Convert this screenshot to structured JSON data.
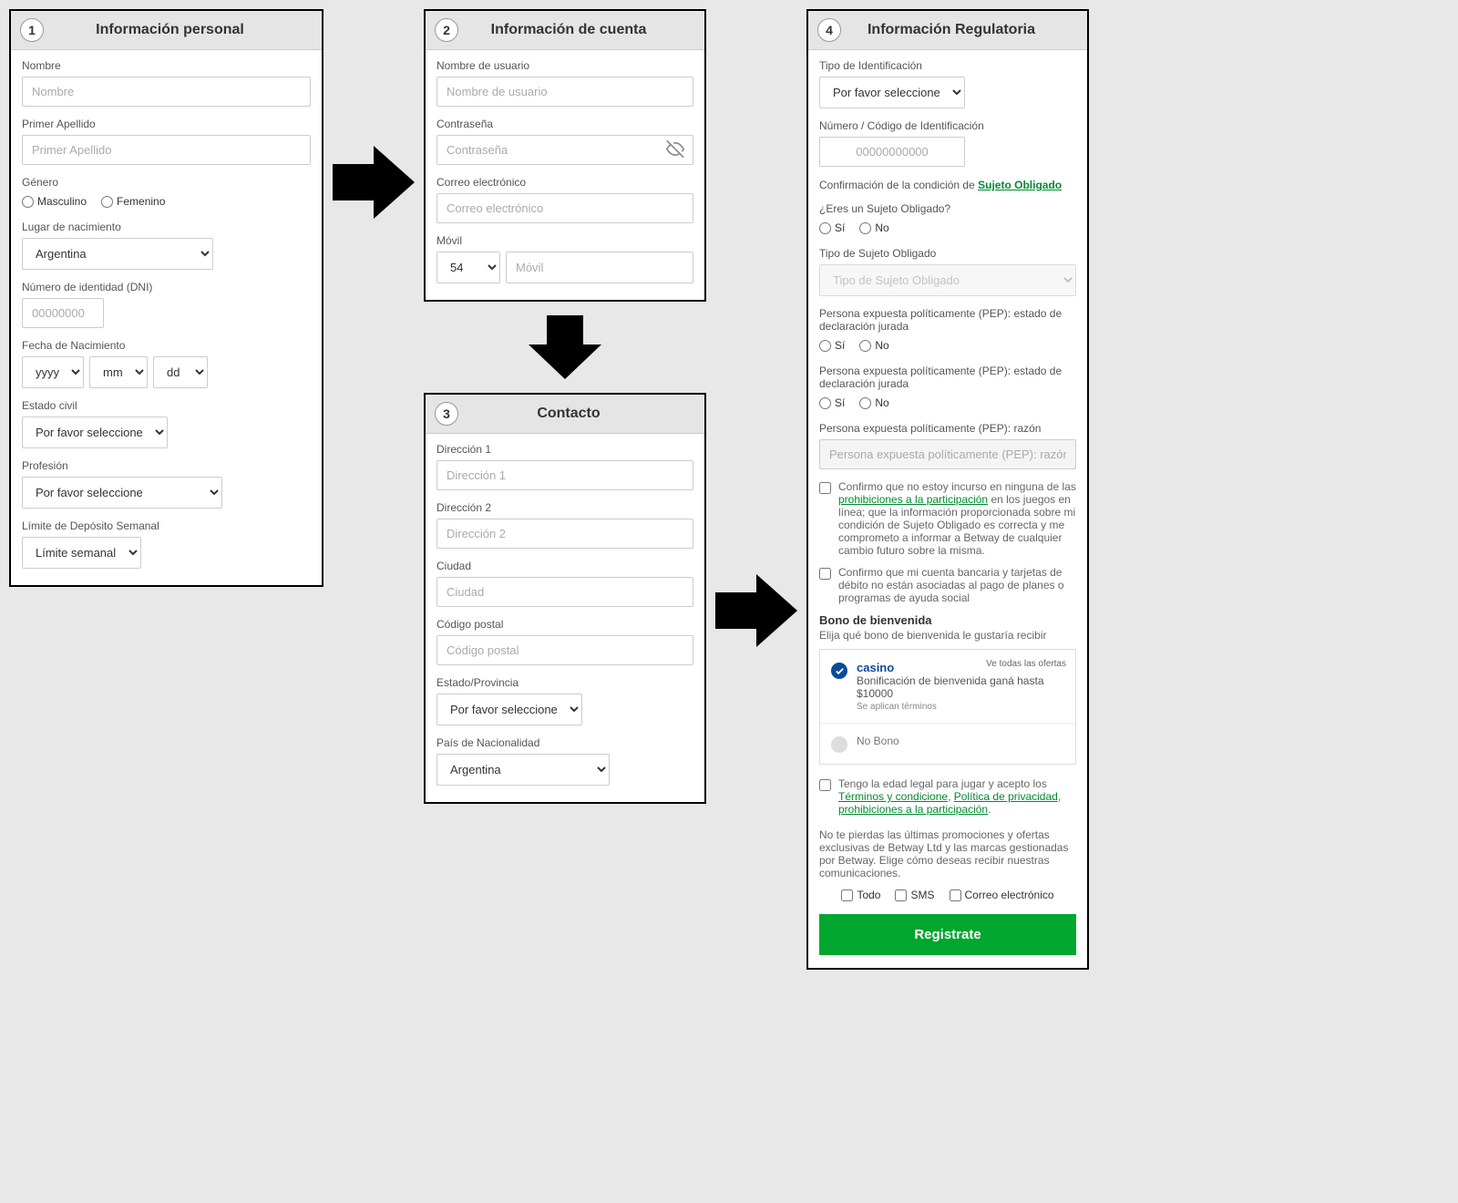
{
  "step1": {
    "number": "1",
    "title": "Información personal",
    "nombre_label": "Nombre",
    "nombre_placeholder": "Nombre",
    "apellido_label": "Primer Apellido",
    "apellido_placeholder": "Primer Apellido",
    "genero_label": "Género",
    "genero_m": "Masculino",
    "genero_f": "Femenino",
    "lugar_label": "Lugar de nacimiento",
    "lugar_value": "Argentina",
    "dni_label": "Número de identidad (DNI)",
    "dni_placeholder": "00000000",
    "fecha_label": "Fecha de Nacimiento",
    "yyyy": "yyyy",
    "mm": "mm",
    "dd": "dd",
    "estado_label": "Estado civil",
    "estado_value": "Por favor seleccione",
    "profesion_label": "Profesión",
    "profesion_value": "Por favor seleccione",
    "limite_label": "Límite de Depósito Semanal",
    "limite_value": "Límite semanal"
  },
  "step2": {
    "number": "2",
    "title": "Información de cuenta",
    "usuario_label": "Nombre de usuario",
    "usuario_placeholder": "Nombre de usuario",
    "contrasena_label": "Contraseña",
    "contrasena_placeholder": "Contraseña",
    "correo_label": "Correo electrónico",
    "correo_placeholder": "Correo electrónico",
    "movil_label": "Móvil",
    "movil_code": "54",
    "movil_placeholder": "Móvil"
  },
  "step3": {
    "number": "3",
    "title": "Contacto",
    "dir1_label": "Dirección 1",
    "dir1_placeholder": "Dirección 1",
    "dir2_label": "Dirección 2",
    "dir2_placeholder": "Dirección 2",
    "ciudad_label": "Ciudad",
    "ciudad_placeholder": "Ciudad",
    "cp_label": "Código postal",
    "cp_placeholder": "Código postal",
    "provincia_label": "Estado/Provincia",
    "provincia_value": "Por favor seleccione",
    "pais_label": "País de Nacionalidad",
    "pais_value": "Argentina"
  },
  "step4": {
    "number": "4",
    "title": "Información Regulatoria",
    "tipo_id_label": "Tipo de Identificación",
    "tipo_id_value": "Por favor seleccione",
    "num_id_label": "Número / Código de Identificación",
    "num_id_placeholder": "00000000000",
    "sujeto_confirm_prefix": "Confirmación de la condición de ",
    "sujeto_link": "Sujeto Obligado",
    "sujeto_q": "¿Eres un Sujeto Obligado?",
    "si": "Sí",
    "no": "No",
    "tipo_sujeto_label": "Tipo de Sujeto Obligado",
    "tipo_sujeto_placeholder": "Tipo de Sujeto Obligado",
    "pep1_label": "Persona expuesta políticamente (PEP): estado de declaración jurada",
    "pep2_label": "Persona expuesta políticamente (PEP): estado de declaración jurada",
    "pep_razon_label": "Persona expuesta políticamente (PEP): razón",
    "pep_razon_placeholder": "Persona expuesta políticamente (PEP): razón",
    "confirm1_a": "Confirmo que no estoy incurso en ninguna de las ",
    "confirm1_link": "prohibiciones a la participación",
    "confirm1_b": " en los juegos en línea; que la información proporcionada sobre mi condición de Sujeto Obligado es correcta y me comprometo a informar a Betway de cualquier cambio futuro sobre la misma.",
    "confirm2": "Confirmo que mi cuenta bancaria y tarjetas de débito no están asociadas al pago de planes o programas de ayuda social",
    "bono_header": "Bono de bienvenida",
    "bono_sub": "Elija qué bono de bienvenida le gustaría recibir",
    "bono_all": "Ve todas las ofertas",
    "bono_casino": "casino",
    "bono_casino_desc": "Bonificación de bienvenida ganá hasta $10000",
    "bono_terms": "Se aplican términos",
    "bono_none": "No Bono",
    "legal_a": "Tengo la edad legal para jugar y acepto los ",
    "legal_link1": "Términos y condicione",
    "legal_sep": ", ",
    "legal_link2": "Política de privacidad",
    "legal_link3": "prohibiciones a la participación",
    "legal_period": ".",
    "marketing": "No te pierdas las últimas promociones y ofertas exclusivas de Betway Ltd y las marcas gestionadas por Betway. Elige cómo deseas recibir nuestras comunicaciones.",
    "todo": "Todo",
    "sms": "SMS",
    "email": "Correo electrónico",
    "register": "Registrate"
  }
}
